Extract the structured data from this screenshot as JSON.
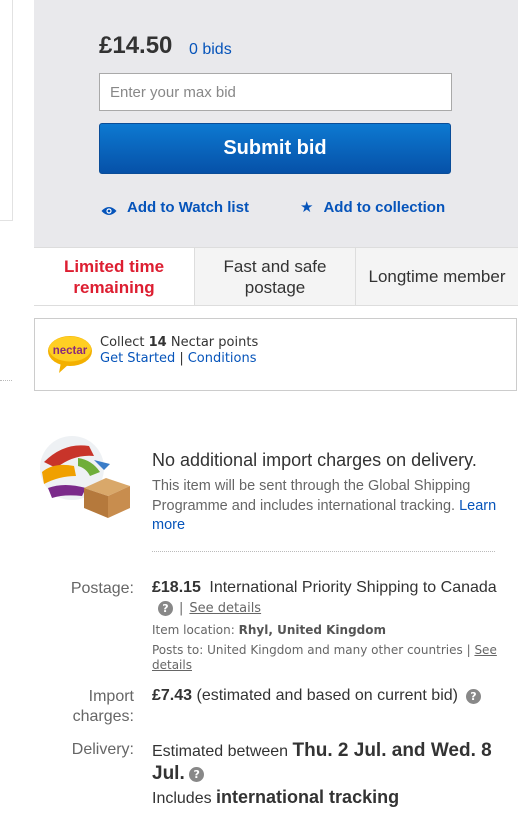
{
  "bid_panel": {
    "price": "£14.50",
    "bids": "0 bids",
    "input_placeholder": "Enter your max bid",
    "submit_label": "Submit bid",
    "watch_label": "Add to Watch list",
    "collection_label": "Add to collection"
  },
  "features": [
    {
      "label": "Limited time remaining"
    },
    {
      "label": "Fast and safe postage"
    },
    {
      "label": "Longtime member"
    }
  ],
  "nectar": {
    "logo_text": "nectar",
    "collect_prefix": "Collect",
    "points": "14",
    "collect_suffix": "Nectar points",
    "get_started": "Get Started",
    "separator": "|",
    "conditions": "Conditions"
  },
  "shipping": {
    "import_title": "No additional import charges on delivery.",
    "import_desc": "This item will be sent through the Global Shipping Programme and includes international tracking.",
    "learn_more": "Learn more",
    "postage_label": "Postage:",
    "postage_price": "£18.15",
    "postage_service": "International Priority Shipping to Canada",
    "postage_separator": "|",
    "see_details": "See details",
    "item_location_label": "Item location:",
    "item_location": "Rhyl, United Kingdom",
    "posts_to_label": "Posts to:",
    "posts_to": "United Kingdom and many other countries",
    "posts_sep": "|",
    "see_details_2": "See details",
    "import_charges_label_1": "Import",
    "import_charges_label_2": "charges:",
    "import_charges_value": "£7.43",
    "import_charges_note": "(estimated and based on current bid)",
    "delivery_label": "Delivery:",
    "delivery_prefix": "Estimated between",
    "delivery_range": "Thu. 2 Jul. and Wed. 8 Jul.",
    "delivery_includes": "Includes",
    "delivery_tracking": "international tracking",
    "help_glyph": "?"
  },
  "colors": {
    "primary_button": "#0654ba",
    "link": "#0654ba",
    "urgent": "#dd1e31",
    "panel_bg": "#e9e9ec"
  }
}
